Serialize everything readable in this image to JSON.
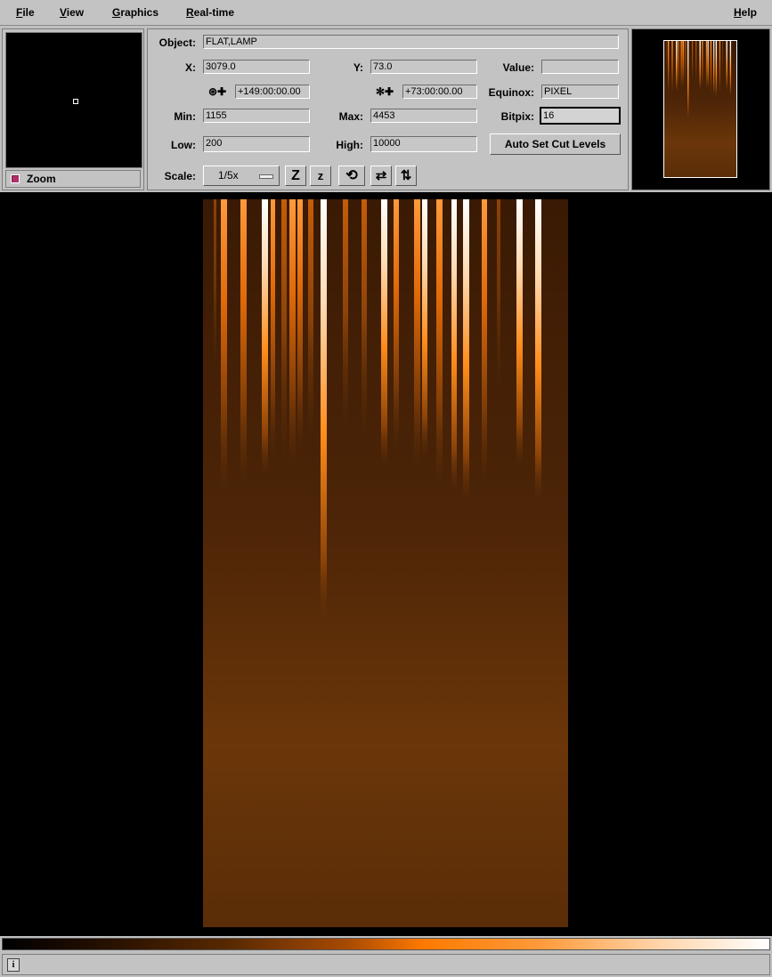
{
  "menubar": {
    "file": "File",
    "view": "View",
    "graphics": "Graphics",
    "realtime": "Real-time",
    "help": "Help"
  },
  "zoom": {
    "toggle_label": "Zoom",
    "checked": true
  },
  "info": {
    "object_label": "Object:",
    "object_value": "FLAT,LAMP",
    "x_label": "X:",
    "x_value": "3079.0",
    "y_label": "Y:",
    "y_value": "73.0",
    "value_label": "Value:",
    "value_value": "",
    "ra_icon": "ra-crosshair-icon",
    "ra_value": "+149:00:00.00",
    "dec_icon": "dec-crosshair-icon",
    "dec_value": "+73:00:00.00",
    "equinox_label": "Equinox:",
    "equinox_value": "PIXEL",
    "min_label": "Min:",
    "min_value": "1155",
    "max_label": "Max:",
    "max_value": "4453",
    "bitpix_label": "Bitpix:",
    "bitpix_value": "16",
    "low_label": "Low:",
    "low_value": "200",
    "high_label": "High:",
    "high_value": "10000",
    "auto_cut_label": "Auto Set Cut Levels",
    "scale_label": "Scale:",
    "scale_value": "1/5x",
    "tools": [
      {
        "name": "zoom-in-icon",
        "glyph": "Z"
      },
      {
        "name": "zoom-out-icon",
        "glyph": "z"
      },
      {
        "name": "rotate-icon",
        "glyph": "⟲"
      },
      {
        "name": "flip-x-icon",
        "glyph": "⇄"
      },
      {
        "name": "flip-y-icon",
        "glyph": "⇅"
      }
    ]
  },
  "colors": {
    "accent": "#ff7a00",
    "background": "#c3c3c3",
    "image_base": "#4a2406"
  },
  "status": {
    "text": ""
  }
}
